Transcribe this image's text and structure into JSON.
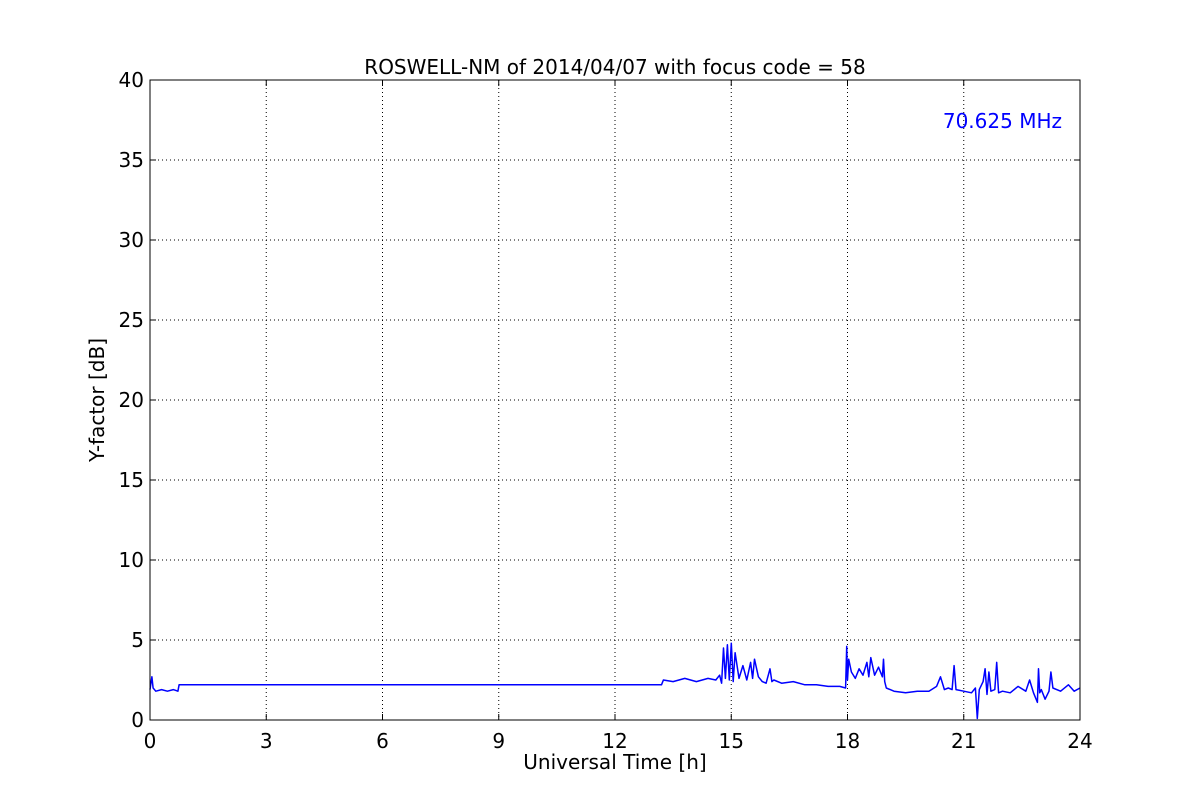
{
  "chart_data": {
    "type": "line",
    "title": "ROSWELL-NM of 2014/04/07 with focus code = 58",
    "xlabel": "Universal Time [h]",
    "ylabel": "Y-factor [dB]",
    "xlim": [
      0,
      24
    ],
    "ylim": [
      0,
      40
    ],
    "xticks": [
      0,
      3,
      6,
      9,
      12,
      15,
      18,
      21,
      24
    ],
    "yticks": [
      0,
      5,
      10,
      15,
      20,
      25,
      30,
      35,
      40
    ],
    "grid": true,
    "annotation": {
      "text": "70.625 MHz",
      "color": "#0000ff",
      "placement": "top-right"
    },
    "series": [
      {
        "color": "#0000ff",
        "x": [
          0.0,
          0.05,
          0.08,
          0.15,
          0.3,
          0.45,
          0.6,
          0.72,
          0.75,
          1.5,
          3.0,
          6.0,
          9.0,
          12.0,
          13.2,
          13.25,
          13.5,
          13.8,
          14.1,
          14.4,
          14.6,
          14.7,
          14.75,
          14.8,
          14.85,
          14.9,
          14.95,
          15.0,
          15.05,
          15.1,
          15.2,
          15.3,
          15.4,
          15.5,
          15.55,
          15.6,
          15.7,
          15.8,
          15.9,
          16.0,
          16.05,
          16.1,
          16.3,
          16.6,
          16.9,
          17.2,
          17.5,
          17.8,
          17.95,
          17.98,
          18.0,
          18.03,
          18.1,
          18.2,
          18.3,
          18.4,
          18.5,
          18.55,
          18.6,
          18.7,
          18.8,
          18.9,
          18.93,
          18.96,
          19.0,
          19.2,
          19.5,
          19.8,
          20.1,
          20.3,
          20.4,
          20.5,
          20.6,
          20.7,
          20.75,
          20.8,
          21.0,
          21.2,
          21.3,
          21.35,
          21.4,
          21.5,
          21.55,
          21.6,
          21.65,
          21.7,
          21.8,
          21.85,
          21.9,
          22.0,
          22.2,
          22.4,
          22.6,
          22.7,
          22.8,
          22.9,
          22.93,
          22.96,
          23.0,
          23.1,
          23.2,
          23.25,
          23.3,
          23.5,
          23.7,
          23.85,
          24.0
        ],
        "y": [
          1.9,
          2.7,
          2.0,
          1.8,
          1.9,
          1.8,
          1.9,
          1.8,
          2.2,
          2.2,
          2.2,
          2.2,
          2.2,
          2.2,
          2.2,
          2.5,
          2.4,
          2.6,
          2.4,
          2.6,
          2.5,
          2.8,
          2.3,
          4.5,
          2.6,
          4.7,
          2.5,
          4.8,
          2.4,
          4.2,
          2.6,
          3.4,
          2.5,
          3.6,
          2.6,
          3.8,
          2.7,
          2.4,
          2.3,
          3.2,
          2.4,
          2.5,
          2.3,
          2.4,
          2.2,
          2.2,
          2.1,
          2.1,
          2.0,
          4.6,
          2.5,
          3.8,
          3.0,
          2.6,
          3.2,
          2.8,
          3.6,
          2.7,
          3.9,
          2.8,
          3.3,
          2.7,
          3.8,
          2.4,
          2.0,
          1.8,
          1.7,
          1.8,
          1.8,
          2.1,
          2.7,
          1.9,
          2.0,
          1.9,
          3.4,
          1.9,
          1.8,
          1.7,
          2.0,
          0.1,
          1.9,
          2.4,
          3.2,
          1.6,
          3.0,
          1.8,
          1.9,
          3.6,
          1.7,
          1.8,
          1.7,
          2.1,
          1.8,
          2.5,
          1.7,
          1.1,
          3.2,
          1.7,
          1.9,
          1.3,
          1.8,
          3.0,
          2.0,
          1.8,
          2.2,
          1.8,
          2.0
        ]
      }
    ]
  }
}
